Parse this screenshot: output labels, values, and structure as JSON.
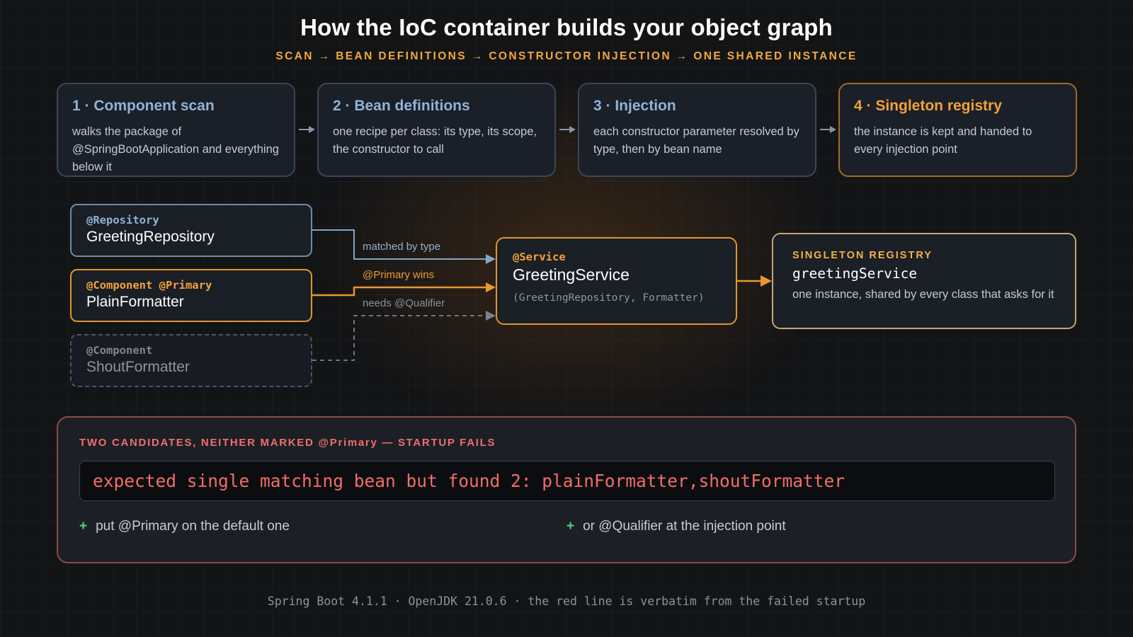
{
  "title": "How the IoC container builds your object graph",
  "subtitle": "SCAN → BEAN DEFINITIONS → CONSTRUCTOR INJECTION → ONE SHARED INSTANCE",
  "steps": [
    {
      "title": "1 · Component scan",
      "desc": "walks the package of @SpringBootApplication and everything below it"
    },
    {
      "title": "2 · Bean definitions",
      "desc": "one recipe per class: its type, its scope, the constructor to call"
    },
    {
      "title": "3 · Injection",
      "desc": "each constructor parameter resolved by type, then by bean name"
    },
    {
      "title": "4 · Singleton registry",
      "desc": "the instance is kept and handed to every injection point"
    }
  ],
  "beans": [
    {
      "annotation": "@Repository",
      "name": "GreetingRepository"
    },
    {
      "annotation": "@Component @Primary",
      "name": "PlainFormatter"
    },
    {
      "annotation": "@Component",
      "name": "ShoutFormatter"
    }
  ],
  "connections": [
    {
      "label": "matched by type"
    },
    {
      "label": "@Primary wins"
    },
    {
      "label": "needs @Qualifier"
    }
  ],
  "service": {
    "annotation": "@Service",
    "name": "GreetingService",
    "signature": "(GreetingRepository, Formatter)"
  },
  "registry": {
    "label": "SINGLETON REGISTRY",
    "name": "greetingService",
    "desc": "one instance, shared by every class that asks for it"
  },
  "error": {
    "label": "TWO CANDIDATES, NEITHER MARKED @Primary — STARTUP FAILS",
    "message": "expected single matching bean but found 2: plainFormatter,shoutFormatter",
    "fixes": [
      {
        "symbol": "+",
        "text": "put @Primary on the default one"
      },
      {
        "symbol": "+",
        "text": "or @Qualifier at the injection point"
      }
    ]
  },
  "footer": "Spring Boot 4.1.1 · OpenJDK 21.0.6 · the red line is verbatim from the failed startup",
  "colors": {
    "background": "#131416",
    "accent_orange": "#f2a23a",
    "accent_blue": "#8fb3d6",
    "error_red": "#f06e68",
    "fix_green": "#58cf88"
  }
}
